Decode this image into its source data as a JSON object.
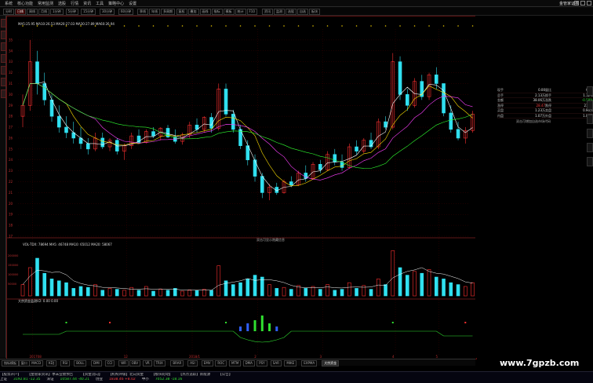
{
  "menu": {
    "items": [
      "系统",
      "核心功能",
      "常用监测",
      "选股",
      "行情",
      "资讯",
      "工具",
      "策略中心",
      "设置"
    ],
    "brand": "金管家证券"
  },
  "toolbar": {
    "buttons": [
      "分时",
      "日线",
      "周线",
      "月线",
      "1分钟",
      "5分钟",
      "15分钟",
      "30分钟",
      "60分钟",
      "季线",
      "年线",
      "多周期",
      "复权",
      "叠加",
      "画线",
      "指标",
      "模板",
      "统计",
      "F10",
      "资讯",
      "监测",
      "选股",
      "自选",
      "板块"
    ]
  },
  "chart": {
    "main_legend": "MA5:25.95 MA10:26.53 MA20:27.03 MA30:27.89 MA60:26.94",
    "volume_legend": "VOL-TDX: 78694   MA5: 46748   MA10: 65012   MA20: 58067",
    "indicator_legend": "大宗资金监测V2: 0.00 0.00",
    "note_mid": "双击可显示隐藏信息",
    "price_ticks": [
      "35",
      "34",
      "33",
      "32",
      "31",
      "30",
      "29",
      "28",
      "27",
      "26",
      "25",
      "24",
      "23",
      "22",
      "21",
      "20",
      "19",
      "18",
      "17"
    ],
    "vol_ticks": [
      "200000",
      "150000",
      "100000",
      "50000"
    ],
    "time_ticks": [
      "201708",
      "12",
      "2018/1",
      "2",
      "3",
      "4",
      "5"
    ],
    "colors": {
      "up": "#ff3030",
      "down": "#30e0f0",
      "ma1": "#ffffff",
      "ma2": "#ffe000",
      "ma3": "#ff40ff",
      "ma4": "#30ff30",
      "grid": "#4a0000"
    }
  },
  "chart_data": {
    "type": "candlestick",
    "ylim": [
      17,
      36
    ],
    "candles": [
      [
        28,
        30,
        27,
        29
      ],
      [
        29,
        35,
        28.5,
        33
      ],
      [
        33,
        34,
        30,
        31
      ],
      [
        31,
        32,
        29,
        29.5
      ],
      [
        29.5,
        30,
        27.5,
        28
      ],
      [
        28,
        29,
        26.5,
        27
      ],
      [
        27,
        28,
        26,
        26.5
      ],
      [
        26.5,
        27.5,
        25.5,
        26
      ],
      [
        26,
        27,
        25,
        25.5
      ],
      [
        25.5,
        26,
        24.5,
        25
      ],
      [
        25,
        26.5,
        24.8,
        26
      ],
      [
        26,
        26.5,
        25,
        25.2
      ],
      [
        25.2,
        26,
        24.8,
        25.8
      ],
      [
        25.8,
        26,
        24.5,
        24.8
      ],
      [
        24.8,
        25.5,
        24,
        25.3
      ],
      [
        25.3,
        26.5,
        25,
        26.2
      ],
      [
        26.2,
        26.8,
        25.5,
        25.6
      ],
      [
        25.6,
        26.8,
        25.5,
        26.6
      ],
      [
        26.6,
        27,
        26,
        26.2
      ],
      [
        26.2,
        27,
        25.8,
        26.9
      ],
      [
        26.9,
        27.2,
        26,
        26.1
      ],
      [
        26.1,
        26.8,
        25.5,
        25.7
      ],
      [
        25.7,
        26.5,
        25.4,
        26.3
      ],
      [
        26.3,
        27.5,
        26,
        27.2
      ],
      [
        27.2,
        27.8,
        26.5,
        26.8
      ],
      [
        26.8,
        28,
        26.5,
        27.9
      ],
      [
        27.9,
        28.3,
        26.5,
        26.9
      ],
      [
        26.9,
        31,
        26.7,
        30.5
      ],
      [
        30.5,
        31,
        28,
        28.2
      ],
      [
        28.2,
        28.6,
        26.5,
        26.8
      ],
      [
        26.8,
        27.2,
        25,
        25.3
      ],
      [
        25.3,
        25.8,
        23.5,
        24
      ],
      [
        24,
        24.5,
        22,
        22.5
      ],
      [
        22.5,
        22.8,
        20.5,
        21
      ],
      [
        21,
        21.8,
        20.3,
        21.5
      ],
      [
        21.5,
        21.9,
        20.8,
        21
      ],
      [
        21,
        22.2,
        20.9,
        22
      ],
      [
        22,
        22.5,
        21.5,
        21.7
      ],
      [
        21.7,
        23,
        21.6,
        22.8
      ],
      [
        22.8,
        23.5,
        22,
        22.3
      ],
      [
        22.3,
        23.8,
        22.2,
        23.6
      ],
      [
        23.6,
        24,
        22.8,
        23.1
      ],
      [
        23.1,
        24.8,
        23,
        24.5
      ],
      [
        24.5,
        25,
        23.5,
        23.8
      ],
      [
        23.8,
        24.5,
        23,
        23.3
      ],
      [
        23.3,
        25.5,
        23.2,
        25.2
      ],
      [
        25.2,
        25.8,
        24.5,
        24.8
      ],
      [
        24.8,
        26,
        24.6,
        25.8
      ],
      [
        25.8,
        26.5,
        25,
        25.2
      ],
      [
        25.2,
        27.8,
        25,
        27.5
      ],
      [
        27.5,
        28,
        26.8,
        27
      ],
      [
        27,
        33.8,
        26.8,
        33
      ],
      [
        33,
        33.5,
        29.5,
        30
      ],
      [
        30,
        30.5,
        28.5,
        29
      ],
      [
        29,
        31.5,
        28.8,
        31.2
      ],
      [
        31.2,
        31.8,
        29.5,
        29.8
      ],
      [
        29.8,
        32,
        29.5,
        31.8
      ],
      [
        31.8,
        32.5,
        30.5,
        31
      ],
      [
        31,
        30.5,
        28,
        28.3
      ],
      [
        28.3,
        29,
        26.5,
        26.8
      ],
      [
        26.8,
        27.5,
        25.8,
        26
      ],
      [
        26,
        27,
        25.5,
        26.7
      ],
      [
        26.7,
        28.5,
        26.5,
        28.2
      ]
    ],
    "volume": [
      60000,
      150000,
      200000,
      120000,
      90000,
      80000,
      70000,
      40000,
      50000,
      45000,
      60000,
      30000,
      40000,
      35000,
      30000,
      45000,
      30000,
      50000,
      25000,
      35000,
      30000,
      40000,
      25000,
      30000,
      28000,
      35000,
      30000,
      160000,
      80000,
      60000,
      70000,
      90000,
      110000,
      100000,
      60000,
      40000,
      45000,
      35000,
      55000,
      40000,
      50000,
      35000,
      60000,
      30000,
      35000,
      70000,
      40000,
      55000,
      35000,
      90000,
      60000,
      240000,
      150000,
      110000,
      130000,
      120000,
      140000,
      100000,
      90000,
      70000,
      60000,
      50000,
      70000
    ]
  },
  "right_panel": {
    "quote": [
      [
        "现手",
        "0.00",
        "量比",
        "0.78"
      ],
      [
        "总手",
        "2.13万",
        "换手",
        "1.12%"
      ],
      [
        "金额",
        "38.06万",
        "涨跌",
        "-0.58%"
      ],
      [
        "涨停",
        "28.47",
        "跌停",
        "23.29"
      ],
      [
        "买盘",
        "1.23万",
        "卖盘",
        "0.90万"
      ],
      [
        "内盘",
        "1.07万",
        "外盘",
        "1.06万"
      ]
    ],
    "note": "双击可增加自选市场代码"
  },
  "bottom_tabs": [
    "指标模板",
    "窗口",
    "MACD",
    "KDJ",
    "RSI",
    "BOLL",
    "DMI",
    "CCI",
    "WR",
    "OBV",
    "VR",
    "TRIX",
    "BRAR",
    "ASI",
    "EMV",
    "ROC",
    "MTM",
    "DMA",
    "PSY",
    "SAR",
    "MIKE",
    "EXPMA",
    "大宗资金"
  ],
  "status": {
    "indices": [
      {
        "label": "上证",
        "value": "3192.81",
        "change": "-12.35",
        "color": "#30e030"
      },
      {
        "label": "深证",
        "value": "10587.44",
        "change": "-40.21",
        "color": "#30e030"
      },
      {
        "label": "创业",
        "value": "1838.46",
        "change": "+8.02",
        "color": "#ff4040"
      },
      {
        "label": "中小",
        "value": "7052.38",
        "change": "-18.16",
        "color": "#30e030"
      }
    ],
    "news": [
      "【股票开户】",
      "【金管家资讯】季末业绩预告",
      "【资金流向】",
      "【机构评级】北向资金",
      "【板块轮动】",
      "【热点追踪】新能源",
      "【公告】"
    ]
  },
  "watermark": "www.7gpzb.com"
}
